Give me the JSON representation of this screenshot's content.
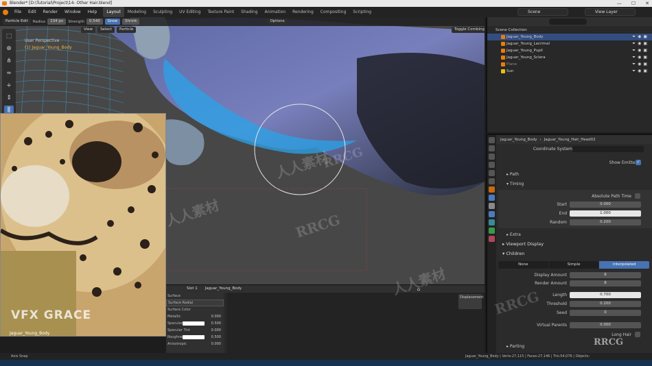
{
  "window": {
    "title": "Blender* [D:\\Tutorial\\Project\\14- Other Hair.blend]",
    "controls": [
      "—",
      "☐",
      "✕"
    ]
  },
  "menu": {
    "items": [
      "File",
      "Edit",
      "Render",
      "Window",
      "Help"
    ],
    "workspaces": [
      "Layout",
      "Modeling",
      "Sculpting",
      "UV Editing",
      "Texture Paint",
      "Shading",
      "Animation",
      "Rendering",
      "Compositing",
      "Scripting"
    ],
    "active_workspace": "Layout",
    "scene": "Scene",
    "view_layer": "View Layer"
  },
  "tool_header": {
    "mode": "Particle Edit",
    "radius_label": "Radius",
    "radius_value": "134 px",
    "strength_label": "Strength",
    "strength_value": "0.540",
    "grow": "Grow",
    "shrink": "Shrink",
    "view": "View",
    "select": "Select",
    "particle": "Particle",
    "options": "Options",
    "toggle_combing": "Toggle Combing"
  },
  "viewport": {
    "perspective": "User Perspective",
    "object_info": "(1) Jaguar_Young_Body"
  },
  "reference": {
    "label": "Jaguar_Young_Body",
    "logo": "VFX GRACE"
  },
  "bottom_editor": {
    "slot": "Slot 1",
    "material": "Jaguar_Young_Body",
    "surface_header": "Surface",
    "shader": "Surface Radial",
    "rows": [
      {
        "label": "Surface Color",
        "value": ""
      },
      {
        "label": "Metallic",
        "value": "0.000"
      },
      {
        "label": "Specular",
        "value": "0.500"
      },
      {
        "label": "Specular Tint",
        "value": "0.000"
      },
      {
        "label": "Roughness",
        "value": "0.500"
      },
      {
        "label": "Anisotropic",
        "value": "0.000"
      }
    ],
    "displacement": "Displacement"
  },
  "outliner": {
    "header": "Scene Collection",
    "rows": [
      {
        "name": "Jaguar_Young_Body",
        "selected": true,
        "color": "#e87d0d"
      },
      {
        "name": "Jaguar_Young_Lacrimal",
        "selected": false,
        "color": "#e87d0d"
      },
      {
        "name": "Jaguar_Young_Pupil",
        "selected": false,
        "color": "#e87d0d"
      },
      {
        "name": "Jaguar_Young_Sclera",
        "selected": false,
        "color": "#e87d0d"
      },
      {
        "name": "Plane",
        "selected": false,
        "color": "#e87d0d"
      },
      {
        "name": "Sun",
        "selected": false,
        "color": "#e8c20d"
      }
    ]
  },
  "properties": {
    "object": "Jaguar_Young_Body",
    "psys": "Jaguar_Young_Hair_Head02",
    "coord_system_label": "Coordinate System",
    "show_emitter_label": "Show Emitter",
    "path": "Path",
    "timing": "Timing",
    "absolute_path_time": "Absolute Path Time",
    "start_label": "Start",
    "start_value": "0.000",
    "end_label": "End",
    "end_value": "1.000",
    "random_label": "Random",
    "random_value": "0.200",
    "extra": "Extra",
    "viewport_display": "Viewport Display",
    "children": "Children",
    "child_modes": [
      "None",
      "Simple",
      "Interpolated"
    ],
    "active_child_mode": "Interpolated",
    "display_amount_label": "Display Amount",
    "display_amount": "8",
    "render_amount_label": "Render Amount",
    "render_amount": "8",
    "length_label": "Length",
    "length": "0.700",
    "threshold_label": "Threshold",
    "threshold": "0.200",
    "seed_label": "Seed",
    "seed": "0",
    "virtual_parents_label": "Virtual Parents",
    "virtual_parents": "0.000",
    "long_hair_label": "Long Hair",
    "parting": "Parting"
  },
  "status": {
    "left": "Axis Snap",
    "right": "Jaguar_Young_Body | Verts:27,115 | Faces:27,146 | Tris:54,076 | Objects:"
  },
  "watermarks": {
    "rrcg": "RRCG",
    "cn": "人人素材"
  }
}
